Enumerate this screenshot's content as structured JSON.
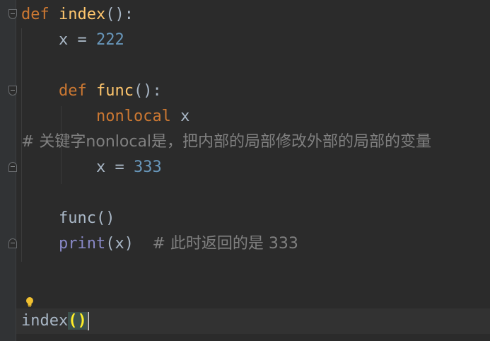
{
  "editor": {
    "lines": {
      "l1": {
        "kw": "def",
        "name": "index",
        "rest": "():"
      },
      "l2": {
        "lhs": "x = ",
        "num": "222"
      },
      "l4": {
        "kw": "def",
        "name": "func",
        "rest": "():"
      },
      "l5": {
        "kw": "nonlocal",
        "rest": " x"
      },
      "l6": {
        "comment": "# 关键字nonlocal是，把内部的局部修改外部的局部的变量"
      },
      "l7": {
        "lhs": "x = ",
        "num": "333"
      },
      "l9": {
        "call": "func()"
      },
      "l10": {
        "builtin": "print",
        "args": "(x)",
        "comment": "# 此时返回的是 333"
      },
      "l12": {
        "name": "index",
        "open": "(",
        "close": ")"
      }
    },
    "colors": {
      "background": "#2b2b2b",
      "keyword": "#cc7832",
      "function": "#ffc66d",
      "number": "#6897bb",
      "builtin": "#8888c6",
      "comment": "#808080",
      "text": "#a9b7c6"
    },
    "icons": [
      "fold-open-icon",
      "fold-close-icon",
      "intention-bulb-icon"
    ]
  }
}
